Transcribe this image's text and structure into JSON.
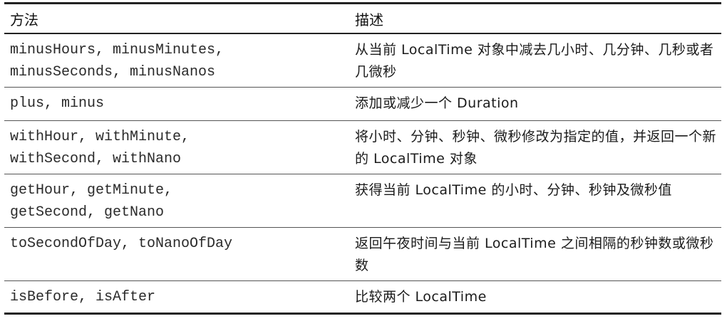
{
  "table": {
    "headers": {
      "method": "方法",
      "description": "描述"
    },
    "rows": [
      {
        "method": "minusHours, minusMinutes,\nminusSeconds, minusNanos",
        "description": "从当前 LocalTime 对象中减去几小时、几分钟、几秒或者几微秒"
      },
      {
        "method": "plus, minus",
        "description": "添加或减少一个 Duration"
      },
      {
        "method": "withHour, withMinute,\nwithSecond, withNano",
        "description": "将小时、分钟、秒钟、微秒修改为指定的值，并返回一个新的 LocalTime 对象"
      },
      {
        "method": "getHour, getMinute,\ngetSecond, getNano",
        "description": "获得当前 LocalTime 的小时、分钟、秒钟及微秒值"
      },
      {
        "method": "toSecondOfDay, toNanoOfDay",
        "description": "返回午夜时间与当前 LocalTime 之间相隔的秒钟数或微秒数"
      },
      {
        "method": "isBefore, isAfter",
        "description": "比较两个 LocalTime"
      }
    ]
  }
}
